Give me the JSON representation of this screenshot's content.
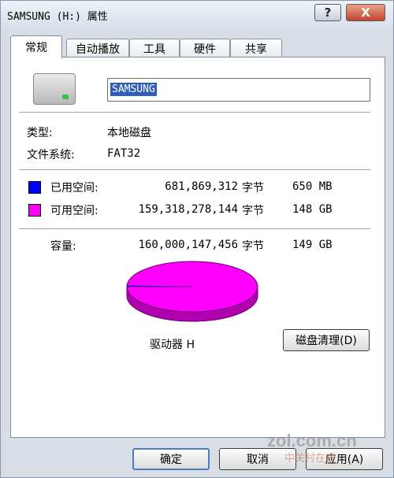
{
  "window": {
    "title": "SAMSUNG (H:) 属性"
  },
  "titlebar": {
    "help_label": "?",
    "close_label": "X"
  },
  "tabs": [
    {
      "label": "常规",
      "active": true
    },
    {
      "label": "自动播放",
      "active": false
    },
    {
      "label": "工具",
      "active": false
    },
    {
      "label": "硬件",
      "active": false
    },
    {
      "label": "共享",
      "active": false
    }
  ],
  "general": {
    "name_value": "SAMSUNG",
    "type_label": "类型:",
    "type_value": "本地磁盘",
    "fs_label": "文件系统:",
    "fs_value": "FAT32",
    "used_label": "已用空间:",
    "used_bytes": "681,869,312",
    "used_unit": "字节",
    "used_size": "650 MB",
    "free_label": "可用空间:",
    "free_bytes": "159,318,278,144",
    "free_unit": "字节",
    "free_size": "148 GB",
    "capacity_label": "容量:",
    "capacity_bytes": "160,000,147,456",
    "capacity_unit": "字节",
    "capacity_size": "149 GB",
    "drive_label": "驱动器 H",
    "cleanup_label": "磁盘清理(D)",
    "used_fraction": 0.004262,
    "used_color": "#0000ff",
    "free_color": "#ff00ff"
  },
  "footer": {
    "ok_label": "确定",
    "cancel_label": "取消",
    "apply_label": "应用(A)"
  },
  "watermark": {
    "text": "zol.com.cn",
    "sub": "中关村在线"
  }
}
